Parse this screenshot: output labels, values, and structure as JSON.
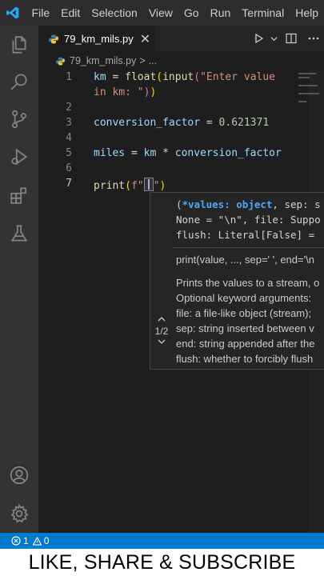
{
  "menubar": {
    "items": [
      "File",
      "Edit",
      "Selection",
      "View",
      "Go",
      "Run",
      "Terminal",
      "Help"
    ]
  },
  "activitybar": {
    "icons": [
      "explorer-icon",
      "search-icon",
      "source-control-icon",
      "run-debug-icon",
      "extensions-icon",
      "testing-icon",
      "account-icon",
      "settings-gear-icon"
    ]
  },
  "tab": {
    "filename": "79_km_mils.py",
    "close_glyph": "✕"
  },
  "breadcrumb": {
    "file": "79_km_mils.py",
    "separator": ">",
    "more": "..."
  },
  "editor": {
    "line_numbers": [
      "1",
      "2",
      "3",
      "4",
      "5",
      "6",
      "7"
    ],
    "active_line": "7",
    "lines": {
      "l1a": "km",
      "l1b": " = ",
      "l1c": "float",
      "l1d": "(",
      "l1e": "input",
      "l1f": "(",
      "l1g": "\"Enter value",
      "l1h": "in km: \"",
      "l1i": ")",
      "l1j": ")",
      "l3a": "conversion_factor",
      "l3b": " = ",
      "l3c": "0.621371",
      "l5a": "miles",
      "l5b": " = ",
      "l5c": "km",
      "l5d": " * ",
      "l5e": "conversion_factor",
      "l7a": "print",
      "l7b": "(",
      "l7c": "f\"",
      "l7d": "{",
      "l7e": "}",
      "l7f": "\"",
      "l7g": ")"
    }
  },
  "signature_help": {
    "line1_pre": "(",
    "line1_param": "*values: object",
    "line1_post": ", sep: s",
    "line2": "None = \"\\n\", file: Suppo",
    "line3": "flush: Literal[False] = ",
    "sig2": "print(value, ..., sep=' ', end='\\n",
    "doc": [
      "Prints the values to a stream, o",
      "Optional keyword arguments:",
      "file: a file-like object (stream);",
      "sep: string inserted between v",
      "end: string appended after the",
      "flush: whether to forcibly flush"
    ],
    "counter": "1/2",
    "up_glyph": "^",
    "down_glyph": "v"
  },
  "statusbar": {
    "errors": "1",
    "warnings": "0"
  },
  "banner": {
    "text": "LIKE, SHARE & SUBSCRIBE"
  },
  "colors": {
    "accent": "#007acc",
    "editor_bg": "#1e1e1e",
    "activitybar_bg": "#333333",
    "keyword_param": "#4fa8f5"
  }
}
